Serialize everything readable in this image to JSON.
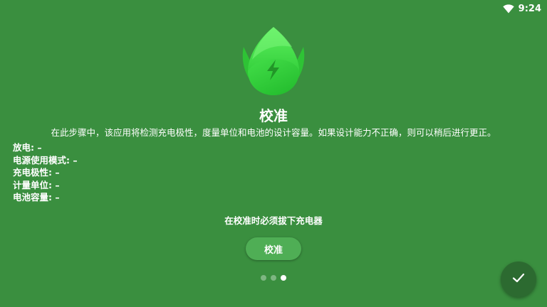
{
  "status_bar": {
    "time": "9:24",
    "wifi_icon": "wifi-icon"
  },
  "logo": {
    "icon": "leaf-bolt-logo-icon",
    "color": "#3fd744"
  },
  "page": {
    "title": "校准",
    "description": "在此步骤中，该应用将检测充电极性，度量单位和电池的设计容量。如果设计能力不正确，则可以稍后进行更正。",
    "info": [
      {
        "label": "放电: –"
      },
      {
        "label": "电源使用模式: –"
      },
      {
        "label": "充电极性: –"
      },
      {
        "label": "计量单位: –"
      },
      {
        "label": "电池容量: –"
      }
    ],
    "notice": "在校准时必须拔下充电器",
    "calibrate_button": "校准"
  },
  "pager": {
    "total": 3,
    "current": 3
  },
  "fab": {
    "icon": "check-icon"
  },
  "colors": {
    "background": "#3a8f3f",
    "button": "#4fae55",
    "fab": "#2c6a30"
  }
}
